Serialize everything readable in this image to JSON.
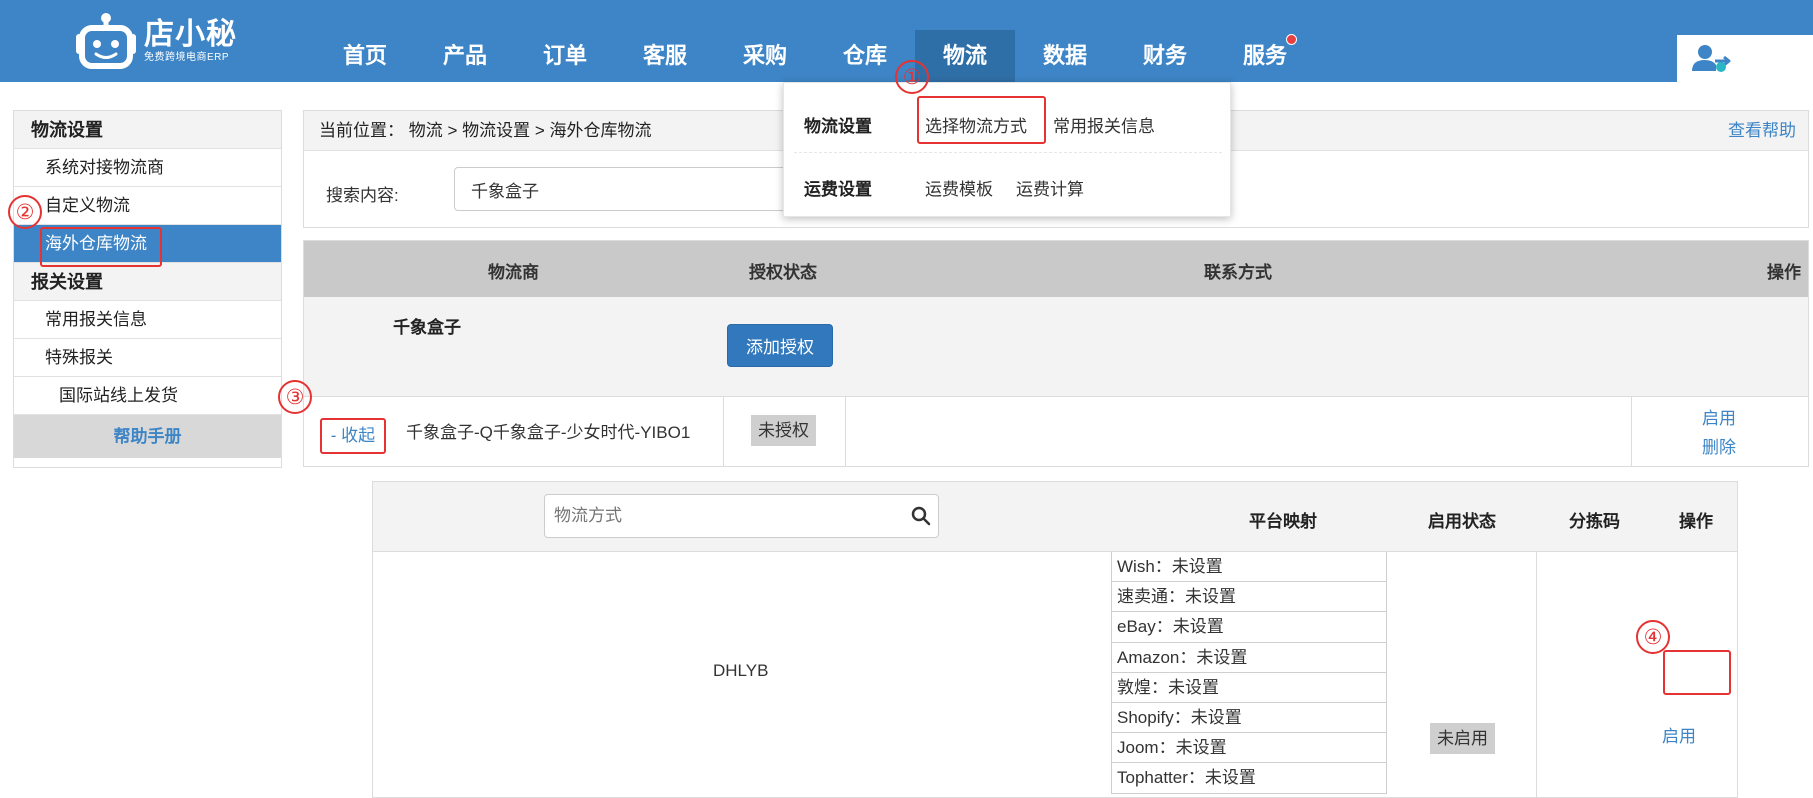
{
  "header": {
    "logo": {
      "title": "店小秘",
      "subtitle": "免费跨境电商ERP"
    },
    "nav": [
      {
        "label": "首页"
      },
      {
        "label": "产品"
      },
      {
        "label": "订单"
      },
      {
        "label": "客服"
      },
      {
        "label": "采购"
      },
      {
        "label": "仓库"
      },
      {
        "label": "物流",
        "active": true
      },
      {
        "label": "数据"
      },
      {
        "label": "财务"
      },
      {
        "label": "服务",
        "has_notification": true
      }
    ],
    "colors": {
      "bar": "#3d85c6",
      "active_tab": "#2f6fa7",
      "notification": "#e84040"
    }
  },
  "dropdown": {
    "groups": [
      {
        "label": "物流设置",
        "links": [
          "选择物流方式",
          "常用报关信息"
        ]
      },
      {
        "label": "运费设置",
        "links": [
          "运费模板",
          "运费计算"
        ]
      }
    ]
  },
  "sidebar": {
    "sections": [
      {
        "title": "物流设置",
        "items": [
          "系统对接物流商",
          "自定义物流",
          "海外仓库物流"
        ]
      },
      {
        "title": "报关设置",
        "items": [
          "常用报关信息",
          "特殊报关",
          "国际站线上发货"
        ]
      }
    ],
    "active_item": "海外仓库物流",
    "help": "帮助手册"
  },
  "breadcrumb": {
    "prefix": "当前位置：",
    "path": [
      "物流",
      "物流设置",
      "海外仓库物流"
    ],
    "separator": ">",
    "help_link": "查看帮助"
  },
  "search": {
    "label": "搜索内容:",
    "value": "千象盒子"
  },
  "provider_table": {
    "columns": [
      "物流商",
      "授权状态",
      "联系方式",
      "操作"
    ],
    "provider": {
      "name": "千象盒子",
      "add_button": "添加授权"
    },
    "account": {
      "collapse": "- 收起",
      "name": "千象盒子-Q千象盒子-少女时代-YIBO1",
      "status": "未授权",
      "actions": [
        "启用",
        "删除"
      ]
    }
  },
  "shipping_table": {
    "search_placeholder": "物流方式",
    "columns": [
      "平台映射",
      "启用状态",
      "分拣码",
      "操作"
    ],
    "row": {
      "method": "DHLYB",
      "mappings": [
        {
          "platform": "Wish",
          "value": "未设置"
        },
        {
          "platform": "速卖通",
          "value": "未设置"
        },
        {
          "platform": "eBay",
          "value": "未设置"
        },
        {
          "platform": "Amazon",
          "value": "未设置"
        },
        {
          "platform": "敦煌",
          "value": "未设置"
        },
        {
          "platform": "Shopify",
          "value": "未设置"
        },
        {
          "platform": "Joom",
          "value": "未设置"
        },
        {
          "platform": "Tophatter",
          "value": "未设置"
        }
      ],
      "status": "未启用",
      "action": "启用"
    }
  },
  "annotations": {
    "markers": [
      "①",
      "②",
      "③",
      "④"
    ],
    "color": "#e53333"
  }
}
